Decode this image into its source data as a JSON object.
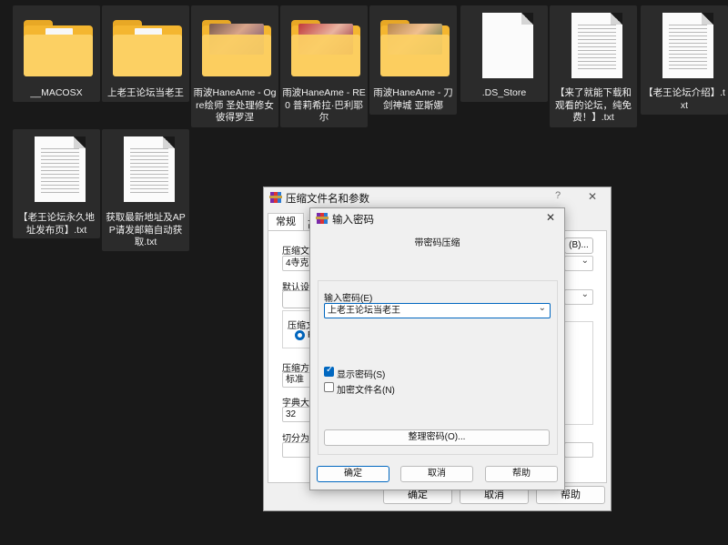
{
  "files": [
    {
      "label": "__MACOSX",
      "kind": "folder",
      "preview": "paper"
    },
    {
      "label": "上老王论坛当老王",
      "kind": "folder",
      "preview": "paper"
    },
    {
      "label": "雨波HaneAme - Ogre绘师 圣处理修女 彼得罗涅",
      "kind": "folder",
      "preview": "photo"
    },
    {
      "label": "雨波HaneAme - RE0 普莉希拉·巴利耶尔",
      "kind": "folder",
      "preview": "photo"
    },
    {
      "label": "雨波HaneAme - 刀剑神城 亚斯娜",
      "kind": "folder",
      "preview": "photo"
    },
    {
      "label": ".DS_Store",
      "kind": "file"
    },
    {
      "label": "【来了就能下载和观看的论坛，纯免费！】.txt",
      "kind": "text"
    },
    {
      "label": "【老王论坛介绍】.txt",
      "kind": "text"
    },
    {
      "label": "【老王论坛永久地址发布页】.txt",
      "kind": "text"
    },
    {
      "label": "获取最新地址及APP请发邮箱自动获取.txt",
      "kind": "text"
    }
  ],
  "archive_dialog": {
    "title": "压缩文件名和参数",
    "help_glyph": "?",
    "close_glyph": "✕",
    "tab_general": "常规",
    "tab_advanced_partial": "高",
    "archive_name_label": "压缩文件",
    "archive_name_value": "4寺克.r",
    "browse_button": "(B)...",
    "profile_label": "默认设置",
    "format_group_label": "压缩文",
    "format_option_partial": "R",
    "method_label": "压缩方式",
    "method_value": "标准",
    "dict_label": "字典大小",
    "dict_value": "32",
    "split_label": "切分为分",
    "ok": "确定",
    "cancel": "取消",
    "help": "帮助"
  },
  "password_dialog": {
    "title": "输入密码",
    "close_glyph": "✕",
    "heading": "带密码压缩",
    "password_label": "输入密码(E)",
    "password_value": "上老王论坛当老王",
    "show_password_label": "显示密码(S)",
    "show_password_checked": true,
    "encrypt_names_label": "加密文件名(N)",
    "encrypt_names_checked": false,
    "organize_button": "整理密码(O)...",
    "ok": "确定",
    "cancel": "取消",
    "help": "帮助"
  },
  "colors": {
    "accent": "#0067c0",
    "folder": "#f4b630",
    "desktop": "#191919"
  }
}
